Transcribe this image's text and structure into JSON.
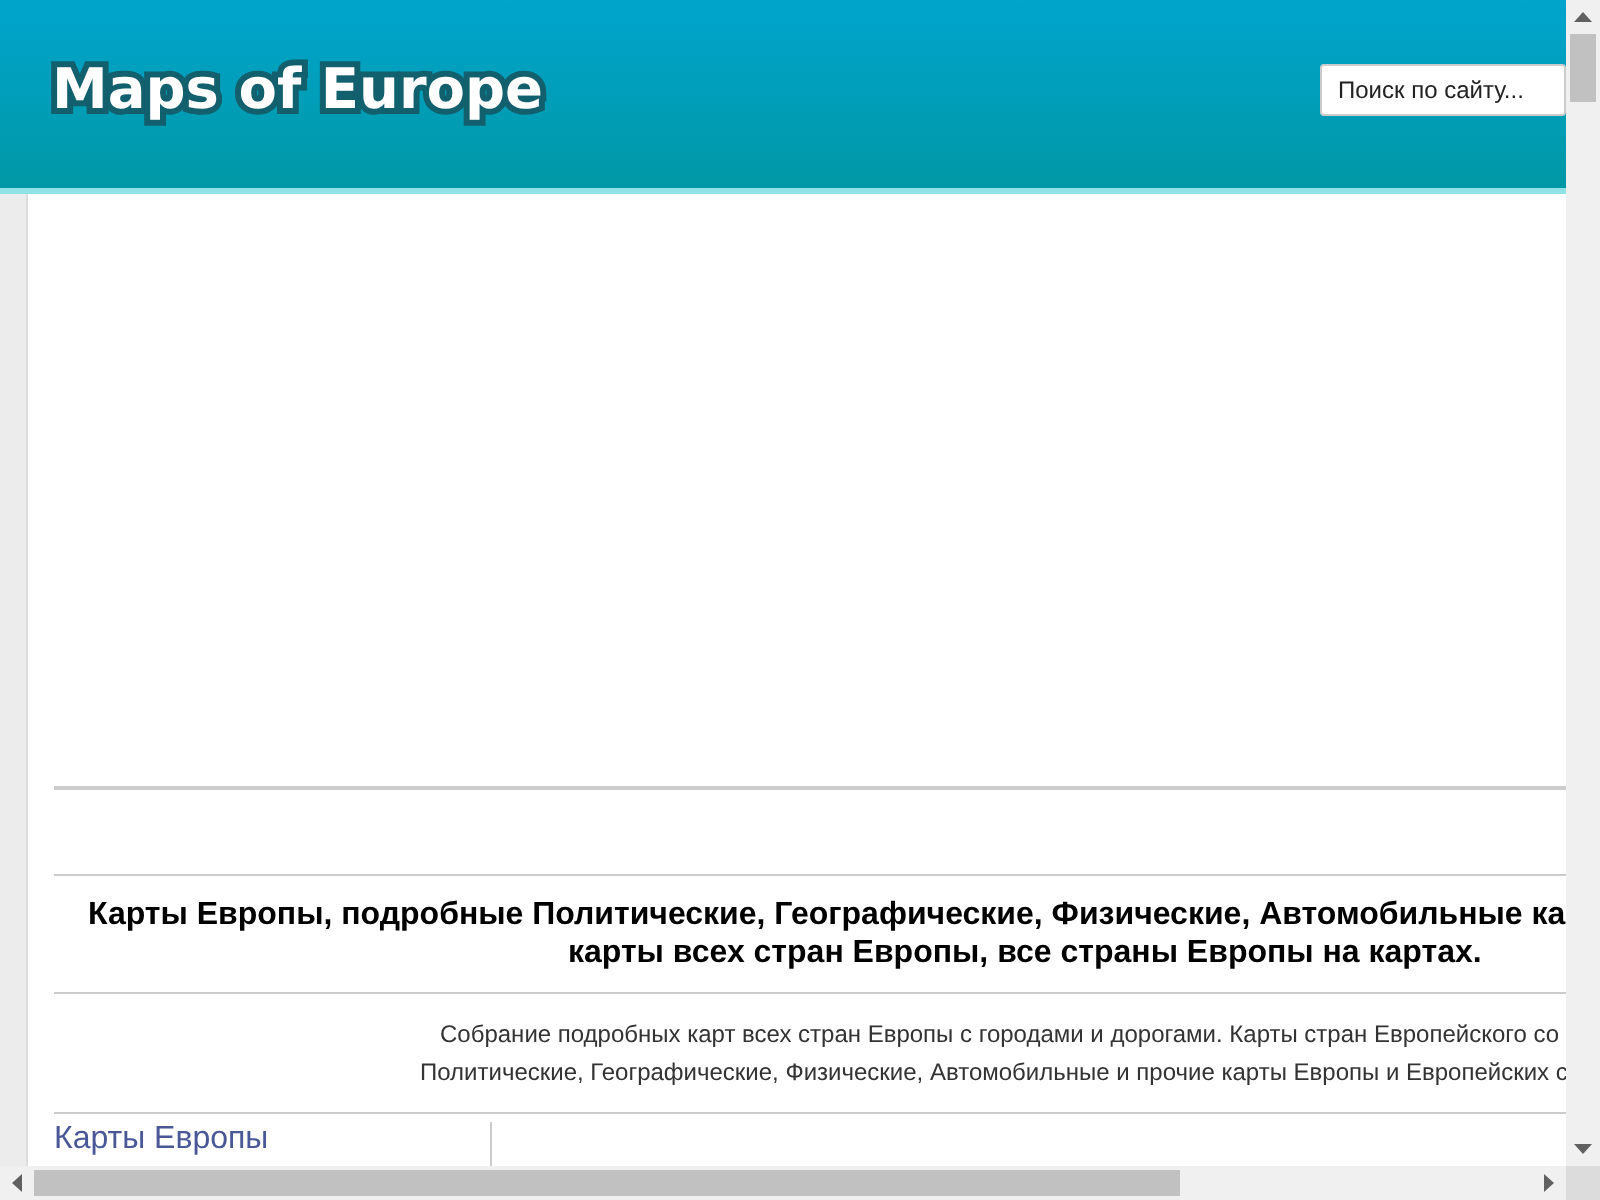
{
  "header": {
    "logo": "Maps of Europe",
    "search": {
      "placeholder": "Поиск по сайту..."
    }
  },
  "main": {
    "heading": [
      "Карты Европы, подробные Политические, Географические, Физические, Автомобильные ка",
      "карты всех стран Европы, все страны Европы на картах."
    ],
    "description": [
      "Собрание подробных карт всех стран Европы с городами и дорогами. Карты стран Европейского со",
      "Политические, Географические, Физические, Автомобильные и прочие карты Европы и Европейских с"
    ],
    "sidebar_title": "Карты Европы"
  }
}
